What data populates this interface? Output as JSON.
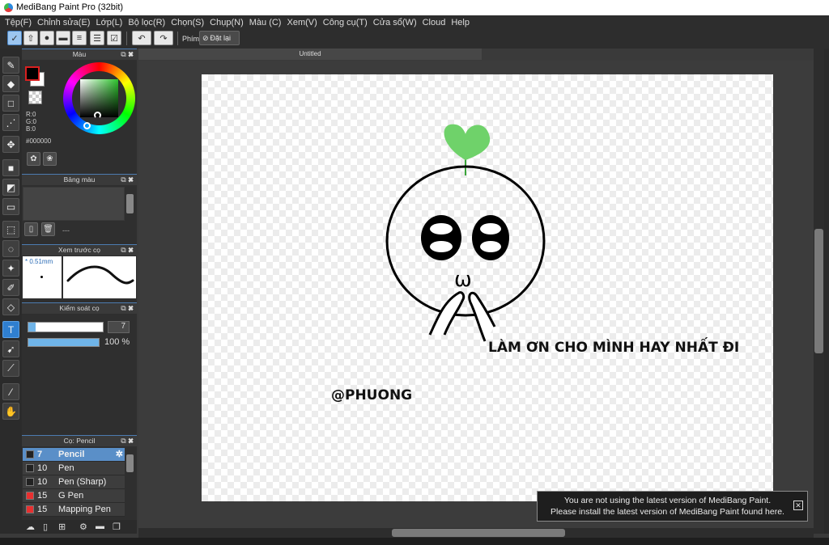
{
  "window": {
    "title": "MediBang Paint Pro (32bit)"
  },
  "menu": [
    "Tệp(F)",
    "Chỉnh sửa(E)",
    "Lớp(L)",
    "Bộ lọc(R)",
    "Chọn(S)",
    "Chụp(N)",
    "Màu (C)",
    "Xem(V)",
    "Công cụ(T)",
    "Cửa sổ(W)",
    "Cloud",
    "Help"
  ],
  "toolbar": {
    "shortcut_label": "Phím",
    "reset_label": "Đặt lại"
  },
  "panels": {
    "color": {
      "title": "Màu",
      "r": "R:0",
      "g": "G:0",
      "b": "B:0",
      "hex": "#000000",
      "fg_color": "#000000",
      "bg_color": "#ffffff"
    },
    "palette": {
      "title": "Bảng màu",
      "empty": "---"
    },
    "brush_preview": {
      "title": "Xem trước cọ",
      "size": "* 0.51mm"
    },
    "brush_control": {
      "title": "Kiểm soát cọ",
      "size_value": "7",
      "opacity": "100 %",
      "size_level": 0.1,
      "opacity_level": 1.0
    },
    "brush_list": {
      "title": "Cọ: Pencil",
      "items": [
        {
          "size": "7",
          "name": "Pencil",
          "selected": true,
          "color": "#222222"
        },
        {
          "size": "10",
          "name": "Pen",
          "color": "#222222"
        },
        {
          "size": "10",
          "name": "Pen (Sharp)",
          "color": "#222222"
        },
        {
          "size": "15",
          "name": "G Pen",
          "color": "#e83030"
        },
        {
          "size": "15",
          "name": "Mapping Pen",
          "color": "#e83030"
        }
      ]
    }
  },
  "document": {
    "tab_title": "Untitled"
  },
  "drawing": {
    "caption": "LÀM ƠN CHO MÌNH HAY NHẤT ĐI",
    "signature": "@PHUONG",
    "mouth": "ω",
    "sprout_color": "#6fd26a"
  },
  "notification": {
    "line1": "You are not using the latest version of MediBang Paint.",
    "line2": "Please install the latest version of MediBang Paint found here."
  }
}
